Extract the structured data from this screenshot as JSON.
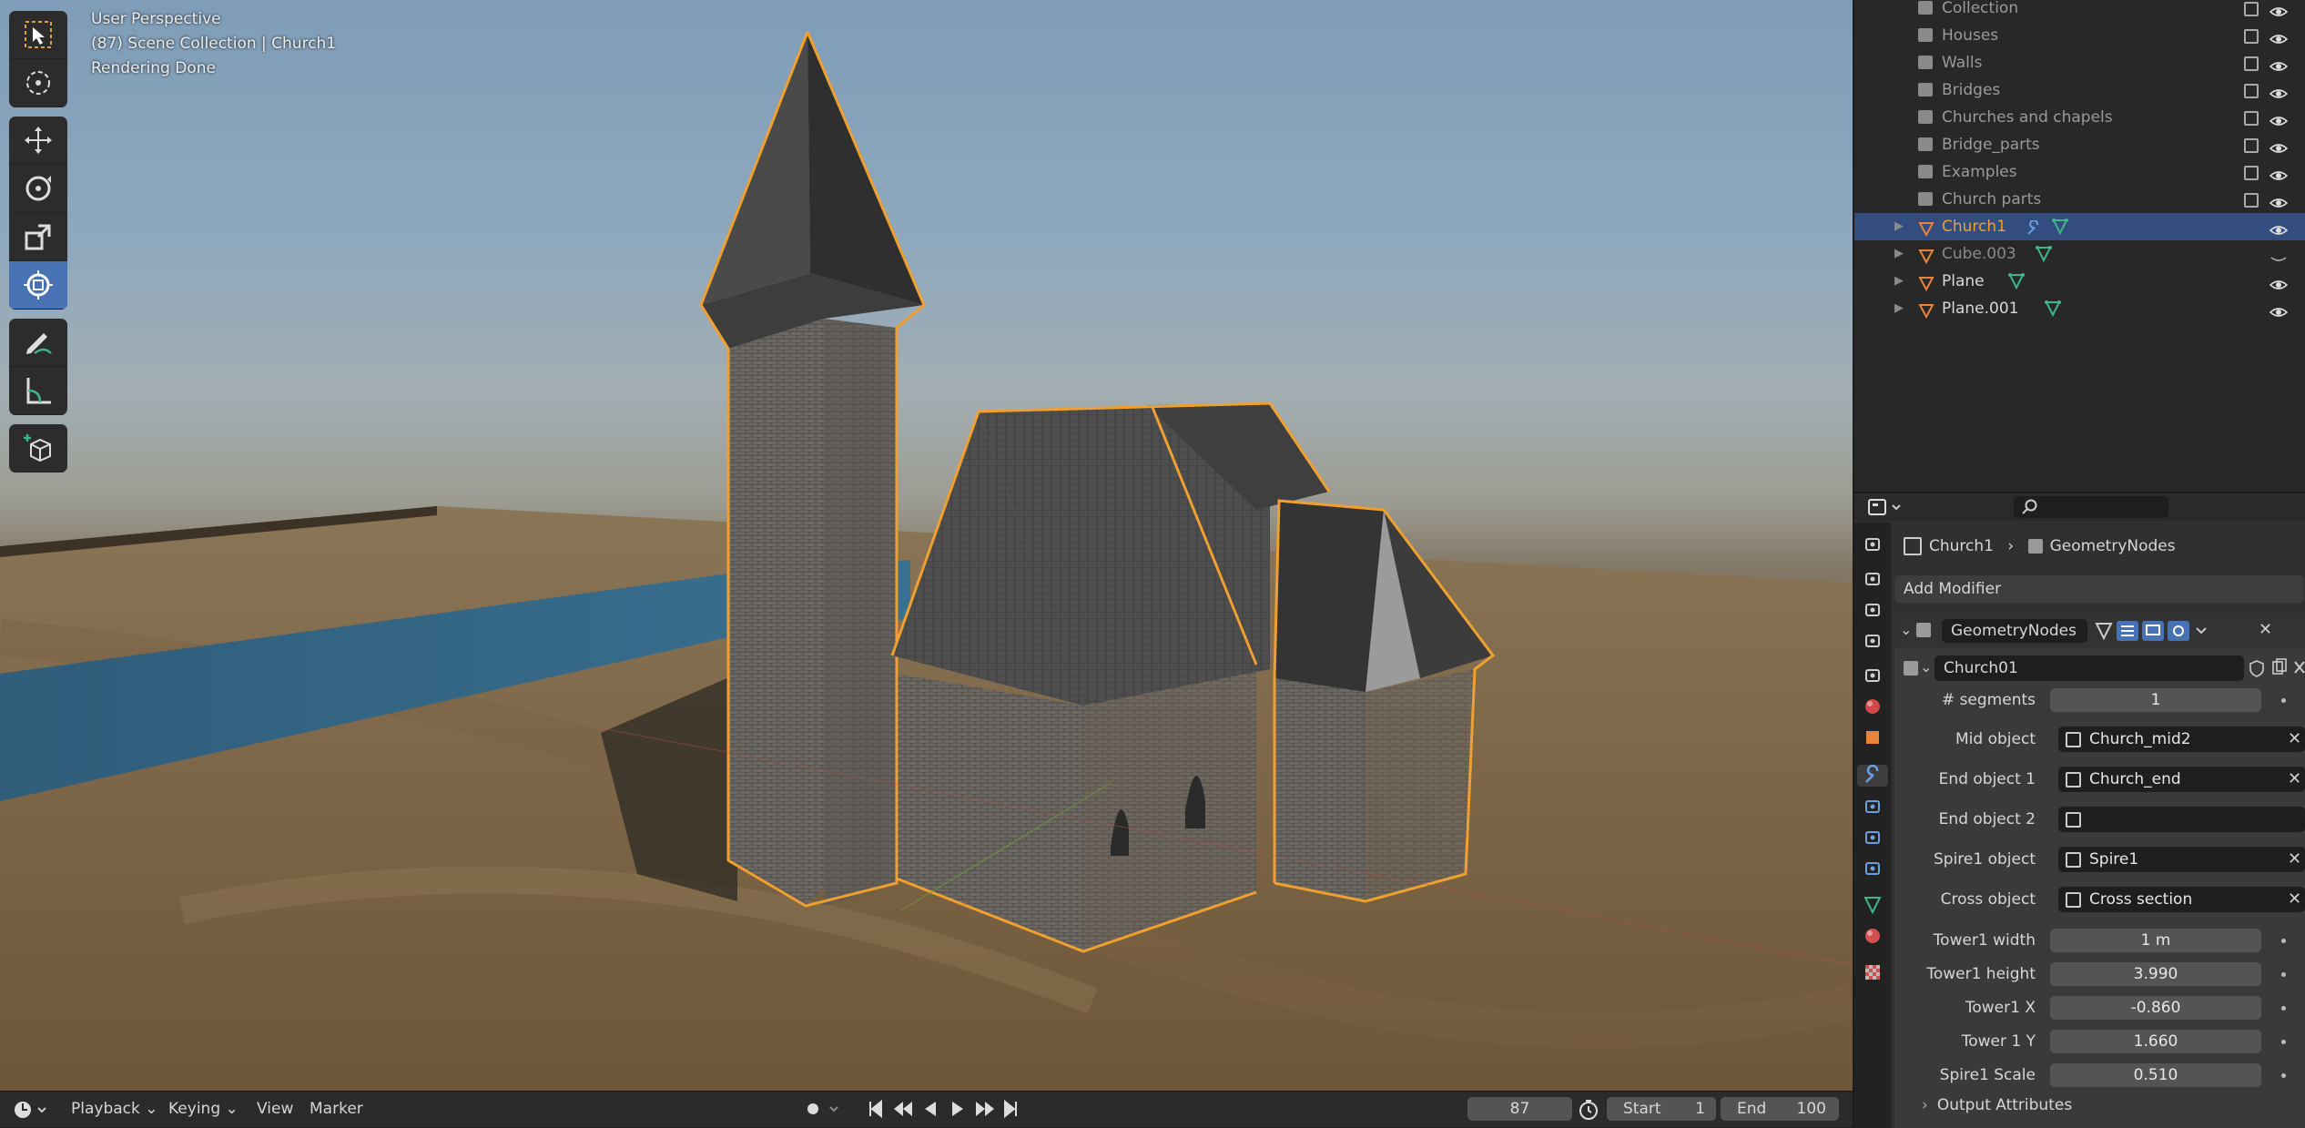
{
  "viewport": {
    "perspective": "User Perspective",
    "context": "(87) Scene Collection | Church1",
    "status": "Rendering Done"
  },
  "toolbar": {
    "tools": [
      "select-box-icon",
      "cursor-icon",
      "move-icon",
      "rotate-icon",
      "scale-icon",
      "transform-icon",
      "annotate-icon",
      "measure-icon",
      "add-cube-icon"
    ],
    "active_tool": "transform-icon"
  },
  "timeline": {
    "playback_label": "Playback",
    "keying_label": "Keying",
    "view_label": "View",
    "marker_label": "Marker",
    "current_frame": "87",
    "start_label": "Start",
    "start_value": "1",
    "end_label": "End",
    "end_value": "100"
  },
  "outliner": {
    "collections": [
      "Collection",
      "Houses",
      "Walls",
      "Bridges",
      "Churches and chapels",
      "Bridge_parts",
      "Examples",
      "Church parts"
    ],
    "objects": [
      "Church1",
      "Cube.003",
      "Plane",
      "Plane.001"
    ],
    "selected": "Church1"
  },
  "properties": {
    "search_placeholder": "",
    "breadcrumb_object": "Church1",
    "breadcrumb_modifier": "GeometryNodes",
    "add_modifier_label": "Add Modifier",
    "modifier_name": "GeometryNodes",
    "node_group": "Church01",
    "fields": {
      "segments_label": "# segments",
      "segments_value": "1",
      "mid_object_label": "Mid object",
      "mid_object_value": "Church_mid2",
      "end_object1_label": "End object 1",
      "end_object1_value": "Church_end",
      "end_object2_label": "End object 2",
      "end_object2_value": "",
      "spire1_object_label": "Spire1 object",
      "spire1_object_value": "Spire1",
      "cross_object_label": "Cross object",
      "cross_object_value": "Cross section",
      "tower1_width_label": "Tower1 width",
      "tower1_width_value": "1 m",
      "tower1_height_label": "Tower1 height",
      "tower1_height_value": "3.990",
      "tower1_x_label": "Tower1 X",
      "tower1_x_value": "-0.860",
      "tower1_y_label": "Tower 1 Y",
      "tower1_y_value": "1.660",
      "spire1_scale_label": "Spire1 Scale",
      "spire1_scale_value": "0.510"
    },
    "output_attributes_label": "Output Attributes"
  },
  "colors": {
    "selection_outline": "#f0a030",
    "active_blue": "#4772b3",
    "row_selected": "#334d80",
    "mesh_orange": "#e8843c",
    "data_green": "#3fb58a"
  }
}
